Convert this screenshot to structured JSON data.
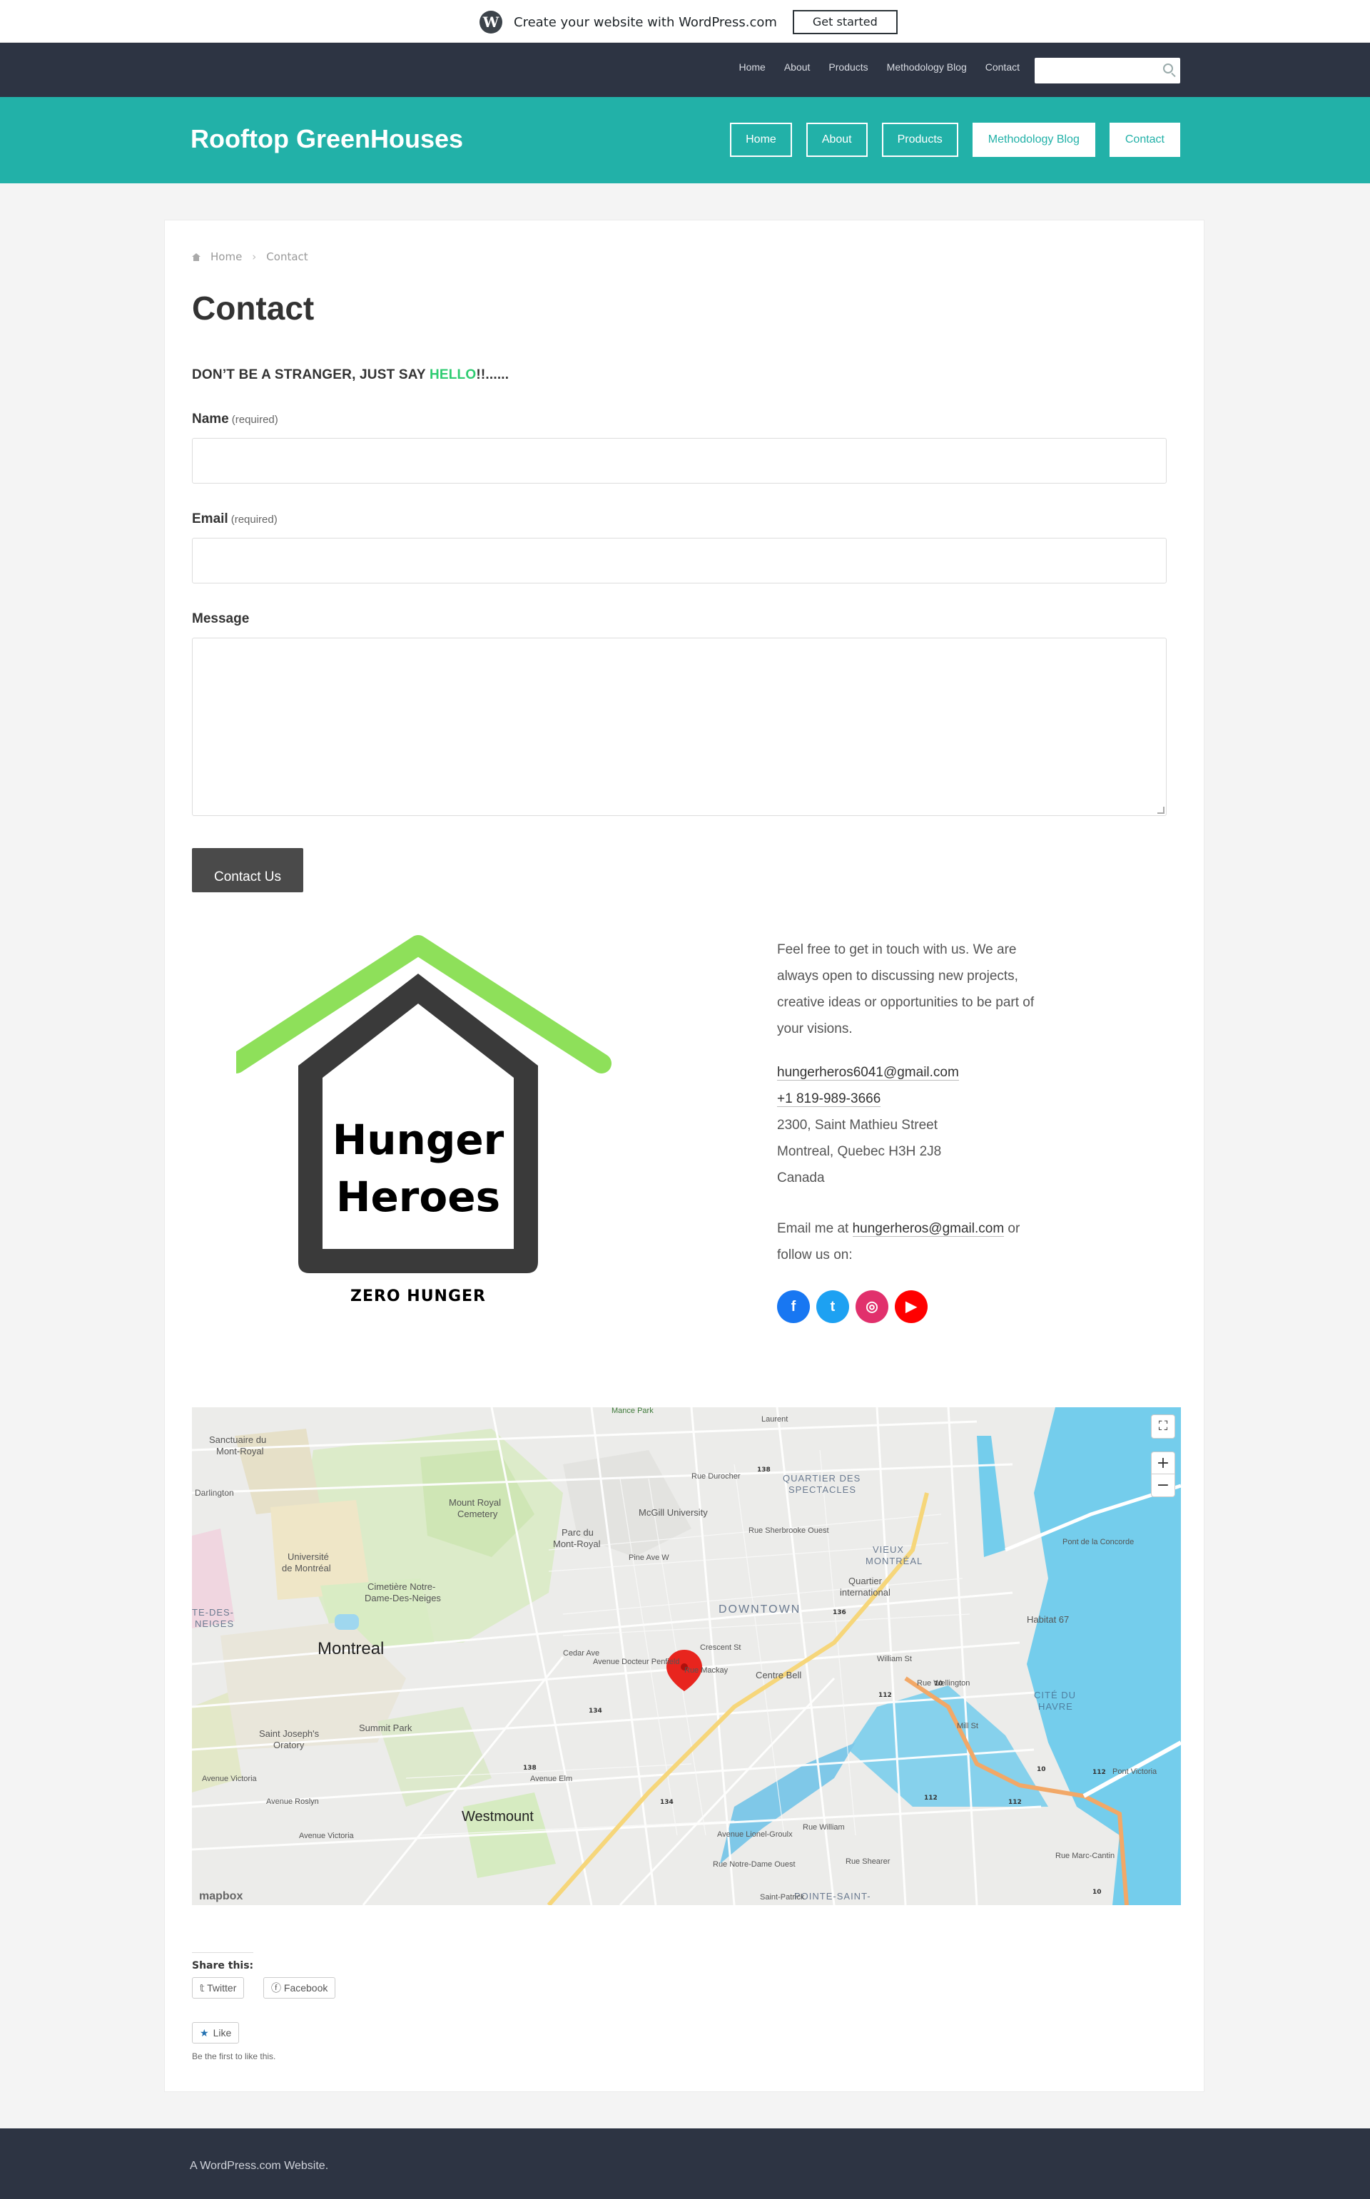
{
  "wpbar": {
    "logo": "W",
    "promo": "Create your website with WordPress.com",
    "cta": "Get started"
  },
  "topnav": {
    "links": [
      "Home",
      "About",
      "Products",
      "Methodology Blog",
      "Contact"
    ],
    "search_placeholder": ""
  },
  "header": {
    "site_title": "Rooftop GreenHouses",
    "nav": [
      "Home",
      "About",
      "Products",
      "Methodology Blog",
      "Contact"
    ]
  },
  "breadcrumb": {
    "home": "Home",
    "current": "Contact"
  },
  "page": {
    "title": "Contact",
    "tagline_a": "DON’T ",
    "tagline_b": "BE A STRANGER, JUST SAY ",
    "tagline_hi": "HELLO",
    "tagline_c": "!!......"
  },
  "form": {
    "name_label": "Name",
    "name_req": "(required)",
    "name_value": "",
    "email_label": "Email",
    "email_req": "(required)",
    "email_value": "",
    "message_label": "Message",
    "message_value": "",
    "submit": "Contact Us"
  },
  "logo": {
    "line1": "Hunger",
    "line2": "Heroes",
    "caption": "ZERO HUNGER",
    "roof_color": "#8ee05a",
    "house_color": "#3a3a3a"
  },
  "about": {
    "intro": [
      "Feel free to get in touch with us. We are",
      "always open to discussing new projects,",
      "creative ideas or opportunities to be part of",
      "your visions."
    ],
    "email": "hungerheros6041@gmail.com",
    "phone": "+1 819-989-3666",
    "address": [
      "2300, Saint Mathieu Street",
      "Montreal, Quebec H3H 2J8",
      "Canada"
    ],
    "email_prefix": "Email me at ",
    "email2": "hungerheros@gmail.com",
    "email_suffix": " or",
    "follow": "follow us on:"
  },
  "social": [
    {
      "icon": "facebook-icon",
      "glyph": "f",
      "color": "#1877f2"
    },
    {
      "icon": "twitter-icon",
      "glyph": "t",
      "color": "#1da1f2"
    },
    {
      "icon": "instagram-icon",
      "glyph": "◎",
      "color": "#e1306c"
    },
    {
      "icon": "youtube-icon",
      "glyph": "▶",
      "color": "#ff0000"
    }
  ],
  "map": {
    "labels": [
      "Sanctuaire du",
      "Mont-Royal",
      "Mount Royal",
      "Cemetery",
      "Parc du",
      "Mont-Royal",
      "McGill University",
      "Université",
      "de Montréal",
      "Cimetière Notre-",
      "Dame-Des-Neiges",
      "Montreal",
      "DOWNTOWN",
      "QUARTIER DES",
      "SPECTACLES",
      "VIEUX",
      "MONTRÉAL",
      "Quartier",
      "international",
      "Centre Bell",
      "Westmount",
      "Summit Park",
      "Saint Joseph's",
      "Oratory",
      "CITÉ DU",
      "HAVRE",
      "Habitat 67",
      "POINTE-SAINT-",
      "TE-DES-",
      "NEIGES",
      "Darlington",
      "Rue Durocher",
      "Rue Sherbrooke Ouest",
      "Pine Ave W",
      "Cedar Ave",
      "Avenue Docteur Penfield",
      "Crescent St",
      "Rue Mackay",
      "Avenue Elm",
      "Avenue Roslyn",
      "Avenue Victoria",
      "Rue Notre-Dame Ouest",
      "Avenue Lionel-Groulx",
      "Rue William",
      "Rue Wellington",
      "Mill St",
      "William St",
      "Pont de la Concorde",
      "Pont Victoria",
      "Rue Marc-Cantin",
      "Rue Shearer",
      "Saint-Patrick",
      "Avenue Victoria",
      "Laurent",
      "Mance Park"
    ],
    "routes": [
      "138",
      "134",
      "136",
      "138",
      "134",
      "112",
      "112",
      "112",
      "10",
      "10",
      "112",
      "10"
    ],
    "attribution": "mapbox",
    "zoom_in": "+",
    "zoom_out": "−",
    "fullscreen": "⛶"
  },
  "share": {
    "heading": "Share this:",
    "twitter": "Twitter",
    "facebook": "Facebook"
  },
  "like": {
    "label": "Like",
    "note": "Be the first to like this."
  },
  "footer": {
    "text": "A WordPress.com Website."
  }
}
